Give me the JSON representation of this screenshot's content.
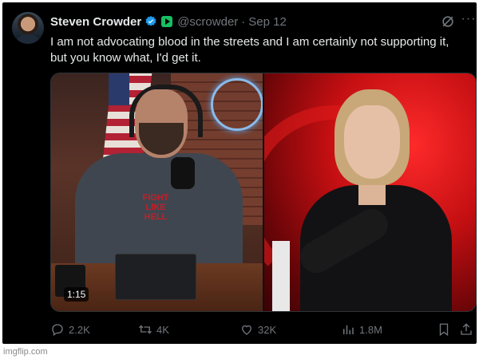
{
  "post": {
    "author_name": "Steven Crowder",
    "handle": "@scrowder",
    "separator": "·",
    "date": "Sep 12",
    "text": "I am not advocating blood in the streets and I am certainly not supporting it, but you know what, I'd get it."
  },
  "media": {
    "duration": "1:15",
    "shirt_text": "FIGHT LIKE HELL"
  },
  "actions": {
    "replies": "2.2K",
    "reposts": "4K",
    "likes": "32K",
    "views": "1.8M"
  },
  "icons": {
    "verified": "verified-badge-icon",
    "affiliate": "affiliate-badge-icon",
    "grok": "grok-icon",
    "more": "more-icon",
    "reply": "reply-icon",
    "repost": "repost-icon",
    "like": "like-icon",
    "views": "views-icon",
    "bookmark": "bookmark-icon",
    "share": "share-icon"
  },
  "colors": {
    "background": "#000000",
    "text_primary": "#e7e9ea",
    "text_secondary": "#71767b",
    "verified": "#1d9bf0"
  },
  "watermark": "imgflip.com"
}
